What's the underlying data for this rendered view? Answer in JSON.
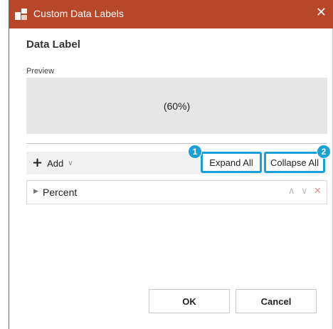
{
  "window": {
    "title": "Custom Data Labels",
    "accent_color": "#b8472a",
    "icons": [
      "app-logo-icon",
      "close-icon"
    ]
  },
  "section": {
    "title": "Data Label",
    "preview_label": "Preview",
    "preview_text": "(60%)"
  },
  "toolbar": {
    "add_label": "Add",
    "expand_all": "Expand All",
    "collapse_all": "Collapse All",
    "highlight_color": "#1aa0d8",
    "badges": [
      "1",
      "2"
    ]
  },
  "list": {
    "items": [
      {
        "label": "Percent",
        "icons": [
          "expand-arrow-icon",
          "move-up-icon",
          "move-down-icon",
          "delete-icon"
        ]
      }
    ]
  },
  "footer": {
    "ok": "OK",
    "cancel": "Cancel"
  }
}
